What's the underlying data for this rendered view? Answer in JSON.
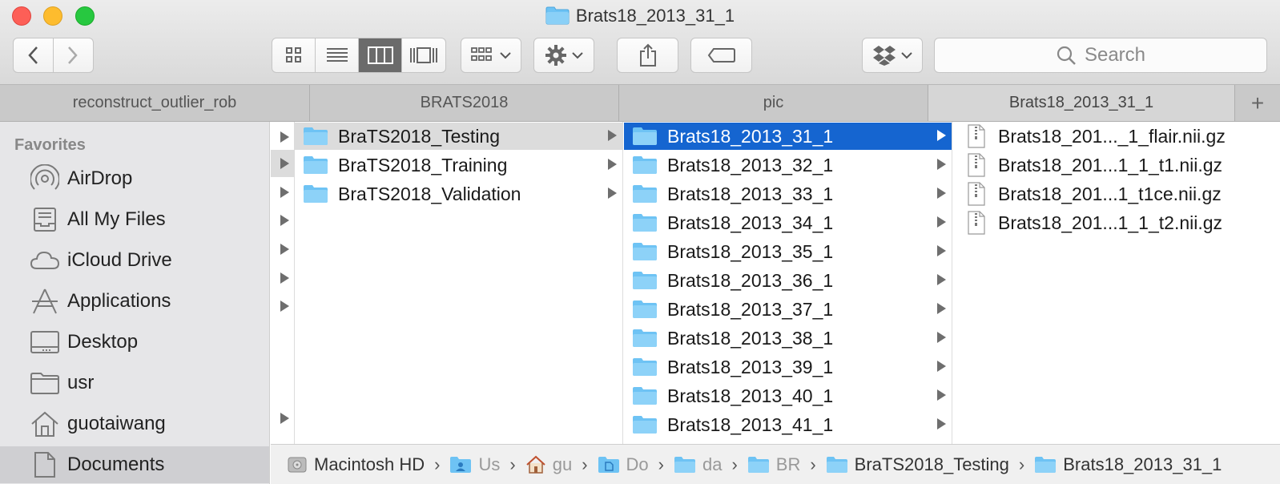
{
  "window": {
    "title": "Brats18_2013_31_1"
  },
  "toolbar": {
    "back_icon": "chevron-left-icon",
    "forward_icon": "chevron-right-icon",
    "view_modes": [
      "icon-view",
      "list-view",
      "column-view",
      "gallery-view"
    ],
    "active_view": "column-view",
    "search_placeholder": "Search"
  },
  "tabs": [
    {
      "label": "reconstruct_outlier_rob",
      "active": false
    },
    {
      "label": "BRATS2018",
      "active": false
    },
    {
      "label": "pic",
      "active": false
    },
    {
      "label": "Brats18_2013_31_1",
      "active": true
    }
  ],
  "tab_add_label": "+",
  "sidebar": {
    "heading": "Favorites",
    "items": [
      {
        "label": "AirDrop",
        "icon": "airdrop-icon"
      },
      {
        "label": "All My Files",
        "icon": "all-files-icon"
      },
      {
        "label": "iCloud Drive",
        "icon": "cloud-icon"
      },
      {
        "label": "Applications",
        "icon": "applications-icon"
      },
      {
        "label": "Desktop",
        "icon": "desktop-icon"
      },
      {
        "label": "usr",
        "icon": "folder-icon"
      },
      {
        "label": "guotaiwang",
        "icon": "home-icon"
      },
      {
        "label": "Documents",
        "icon": "documents-icon"
      }
    ]
  },
  "column1": {
    "items": [
      {
        "label": "BraTS2018_Testing",
        "selected": true
      },
      {
        "label": "BraTS2018_Training",
        "selected": false
      },
      {
        "label": "BraTS2018_Validation",
        "selected": false
      }
    ]
  },
  "column2": {
    "items": [
      {
        "label": "Brats18_2013_31_1",
        "selected": true
      },
      {
        "label": "Brats18_2013_32_1",
        "selected": false
      },
      {
        "label": "Brats18_2013_33_1",
        "selected": false
      },
      {
        "label": "Brats18_2013_34_1",
        "selected": false
      },
      {
        "label": "Brats18_2013_35_1",
        "selected": false
      },
      {
        "label": "Brats18_2013_36_1",
        "selected": false
      },
      {
        "label": "Brats18_2013_37_1",
        "selected": false
      },
      {
        "label": "Brats18_2013_38_1",
        "selected": false
      },
      {
        "label": "Brats18_2013_39_1",
        "selected": false
      },
      {
        "label": "Brats18_2013_40_1",
        "selected": false
      },
      {
        "label": "Brats18_2013_41_1",
        "selected": false
      }
    ]
  },
  "column3": {
    "items": [
      {
        "label": "Brats18_201..._1_flair.nii.gz"
      },
      {
        "label": "Brats18_201...1_1_t1.nii.gz"
      },
      {
        "label": "Brats18_201...1_t1ce.nii.gz"
      },
      {
        "label": "Brats18_201...1_1_t2.nii.gz"
      }
    ]
  },
  "pathbar": [
    {
      "label": "Macintosh HD",
      "icon": "hard-drive-icon"
    },
    {
      "label": "Us",
      "icon": "users-folder-icon"
    },
    {
      "label": "gu",
      "icon": "home-icon"
    },
    {
      "label": "Do",
      "icon": "documents-folder-icon"
    },
    {
      "label": "da",
      "icon": "folder-icon"
    },
    {
      "label": "BR",
      "icon": "folder-icon"
    },
    {
      "label": "BraTS2018_Testing",
      "icon": "folder-icon"
    },
    {
      "label": "Brats18_2013_31_1",
      "icon": "folder-icon"
    }
  ],
  "colors": {
    "selection_blue": "#1565d0",
    "folder_blue": "#6ec3f4",
    "sidebar_bg": "#e6e6e8"
  }
}
